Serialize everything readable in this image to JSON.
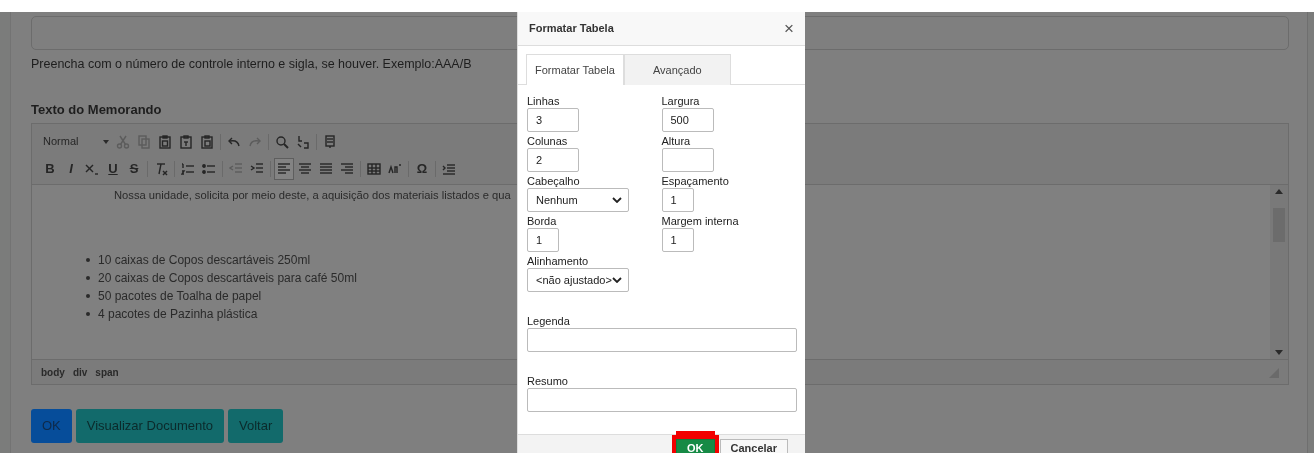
{
  "page": {
    "hint": "Preencha com o número de controle interno e sigla, se houver. Exemplo:AAA/B",
    "section_title": "Texto do Memorando"
  },
  "editor": {
    "toolbar_rows": [
      [
        {
          "kind": "format",
          "label": "Normal",
          "disabled": false,
          "selected": false
        },
        {
          "kind": "cut",
          "disabled": true,
          "selected": false
        },
        {
          "kind": "copy",
          "disabled": true,
          "selected": false
        },
        {
          "kind": "paste",
          "disabled": false,
          "selected": false
        },
        {
          "kind": "paste-text",
          "disabled": false,
          "selected": false
        },
        {
          "kind": "paste-word",
          "disabled": false,
          "selected": false
        },
        {
          "kind": "sep"
        },
        {
          "kind": "undo",
          "disabled": false,
          "selected": false
        },
        {
          "kind": "redo",
          "disabled": true,
          "selected": false
        },
        {
          "kind": "sep"
        },
        {
          "kind": "find",
          "disabled": false,
          "selected": false
        },
        {
          "kind": "replace",
          "disabled": false,
          "selected": false
        },
        {
          "kind": "sep"
        },
        {
          "kind": "pagebreak",
          "disabled": false,
          "selected": false
        }
      ],
      [
        {
          "kind": "letter",
          "label": "B",
          "disabled": false,
          "selected": false
        },
        {
          "kind": "letter-italic",
          "label": "I",
          "disabled": false,
          "selected": false
        },
        {
          "kind": "subscript",
          "disabled": false,
          "selected": false
        },
        {
          "kind": "letter-underline",
          "label": "U",
          "disabled": false,
          "selected": false
        },
        {
          "kind": "letter-strike",
          "label": "S",
          "disabled": false,
          "selected": false
        },
        {
          "kind": "sep"
        },
        {
          "kind": "removeformat",
          "disabled": false,
          "selected": false
        },
        {
          "kind": "sep"
        },
        {
          "kind": "ol",
          "disabled": false,
          "selected": false
        },
        {
          "kind": "ul",
          "disabled": false,
          "selected": false
        },
        {
          "kind": "sep"
        },
        {
          "kind": "outdent",
          "disabled": true,
          "selected": false
        },
        {
          "kind": "indent",
          "disabled": false,
          "selected": false
        },
        {
          "kind": "sep"
        },
        {
          "kind": "align-left",
          "disabled": false,
          "selected": true
        },
        {
          "kind": "align-center",
          "disabled": false,
          "selected": false
        },
        {
          "kind": "align-justify",
          "disabled": false,
          "selected": false
        },
        {
          "kind": "align-right",
          "disabled": false,
          "selected": false
        },
        {
          "kind": "sep"
        },
        {
          "kind": "table",
          "disabled": false,
          "selected": false
        },
        {
          "kind": "spellcheck",
          "disabled": false,
          "selected": false
        },
        {
          "kind": "sep"
        },
        {
          "kind": "letter",
          "label": "Ω",
          "disabled": false,
          "selected": false
        },
        {
          "kind": "sep"
        },
        {
          "kind": "blockquote",
          "disabled": false,
          "selected": false
        }
      ]
    ],
    "paragraph": "Nossa unidade, solicita por meio deste, a aquisição dos materiais listados e qua",
    "items": [
      "10 caixas de Copos descartáveis 250ml",
      "20 caixas de Copos descartáveis para café 50ml",
      "50 pacotes de Toalha de papel",
      "4 pacotes de Pazinha plástica"
    ],
    "path": [
      "body",
      "div",
      "span"
    ]
  },
  "buttons": [
    {
      "label": "OK",
      "kind": "primary"
    },
    {
      "label": "Visualizar Documento",
      "kind": "info"
    },
    {
      "label": "Voltar",
      "kind": "info"
    }
  ],
  "dialog": {
    "title": "Formatar Tabela",
    "close": "×",
    "tabs": [
      {
        "label": "Formatar Tabela",
        "selected": true
      },
      {
        "label": "Avançado",
        "selected": false
      }
    ],
    "rows": [
      [
        {
          "label": "Linhas",
          "kind": "text",
          "value": "3"
        },
        {
          "label": "Largura",
          "kind": "text",
          "value": "500"
        }
      ],
      [
        {
          "label": "Colunas",
          "kind": "text",
          "value": "2"
        },
        {
          "label": "Altura",
          "kind": "text"
        }
      ],
      [
        {
          "label": "Cabeçalho",
          "kind": "select",
          "value": "Nenhum"
        },
        {
          "label": "Espaçamento",
          "kind": "short",
          "value": "1"
        }
      ],
      [
        {
          "label": "Borda",
          "kind": "short",
          "value": "1"
        },
        {
          "label": "Margem interna",
          "kind": "short",
          "value": "1"
        }
      ],
      [
        {
          "label": "Alinhamento",
          "kind": "select",
          "value": "<não ajustado>"
        }
      ],
      [
        {
          "label": "Legenda",
          "kind": "wide"
        }
      ],
      [
        {
          "label": "Resumo",
          "kind": "wide"
        }
      ]
    ],
    "buttons": [
      {
        "label": "OK",
        "kind": "confirm",
        "highlighted": true
      },
      {
        "label": "Cancelar",
        "kind": "cancel",
        "highlighted": false
      }
    ]
  }
}
